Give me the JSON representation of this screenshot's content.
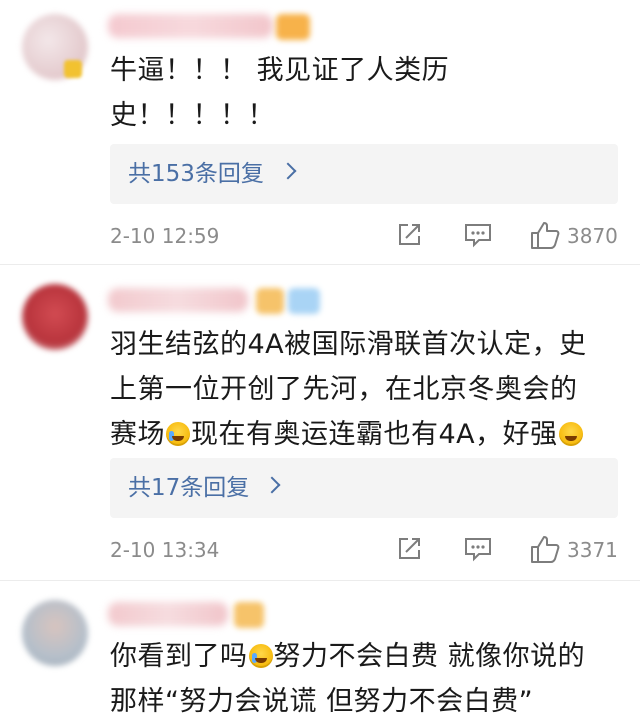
{
  "comments": [
    {
      "avatar_color": "#e9d6d8",
      "text_lines": [
        "牛逼！！！ 我见证了人类历",
        "史！！！！！"
      ],
      "reply_label": "共153条回复",
      "time": "2-10 12:59",
      "likes": "3870"
    },
    {
      "avatar_color": "#c9444a",
      "text_lines": [
        "羽生结弦的4A被国际滑联首次认定，史",
        "上第一位开创了先河，在北京冬奥会的",
        "赛场",
        "现在有奥运连霸也有4A，好强"
      ],
      "reply_label": "共17条回复",
      "time": "2-10 13:34",
      "likes": "3371"
    },
    {
      "avatar_color": "#b9c3cc",
      "text_lines": [
        "你看到了吗",
        "努力不会白费 就像你说的",
        "那样“努力会说谎 但努力不会白费”"
      ]
    }
  ],
  "colors": {
    "reply_link": "#4a6fa5",
    "meta_text": "#8b8b8b",
    "reply_bg": "#f4f4f4"
  },
  "icons": {
    "share": "share-icon",
    "comment": "comment-icon",
    "like": "like-icon",
    "chevron": "chevron-right-icon"
  }
}
